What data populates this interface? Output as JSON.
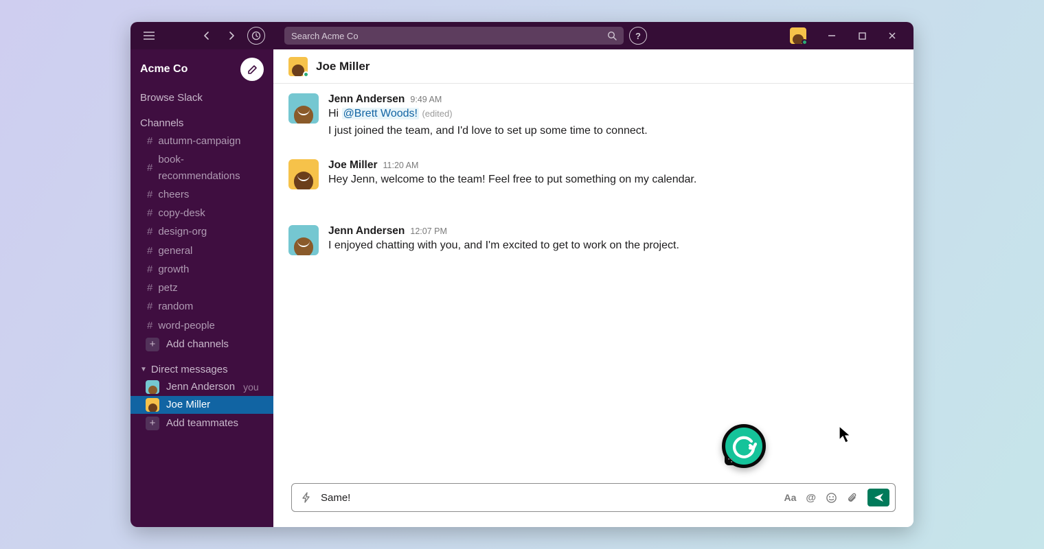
{
  "titlebar": {
    "search_placeholder": "Search Acme Co"
  },
  "workspace": {
    "name": "Acme Co",
    "browse_label": "Browse Slack"
  },
  "channels": {
    "header": "Channels",
    "add_label": "Add channels",
    "items": [
      "autumn-campaign",
      "book-recommendations",
      "cheers",
      "copy-desk",
      "design-org",
      "general",
      "growth",
      "petz",
      "random",
      "word-people"
    ]
  },
  "dms": {
    "header": "Direct messages",
    "add_label": "Add teammates",
    "you_label": "you",
    "items": [
      {
        "name": "Jenn Anderson",
        "you": true,
        "active": false,
        "avatar": "jenn"
      },
      {
        "name": "Joe Miller",
        "you": false,
        "active": true,
        "avatar": "joe"
      }
    ]
  },
  "conversation": {
    "title": "Joe Miller",
    "messages": [
      {
        "author": "Jenn Andersen",
        "time": "9:49 AM",
        "avatar": "jenn",
        "text_prefix": "Hi ",
        "mention": "@Brett Woods!",
        "edited": "(edited)",
        "line2": "I just joined the team, and I'd love to set up some time to connect."
      },
      {
        "author": "Joe Miller",
        "time": "11:20 AM",
        "avatar": "joe",
        "text": "Hey Jenn, welcome to the team!   Feel free to put something on my calendar."
      },
      {
        "author": "Jenn Andersen",
        "time": "12:07 PM",
        "avatar": "jenn",
        "text": "I enjoyed chatting with you, and I'm excited to get to work on the project."
      }
    ]
  },
  "composer": {
    "text": "Same!"
  }
}
